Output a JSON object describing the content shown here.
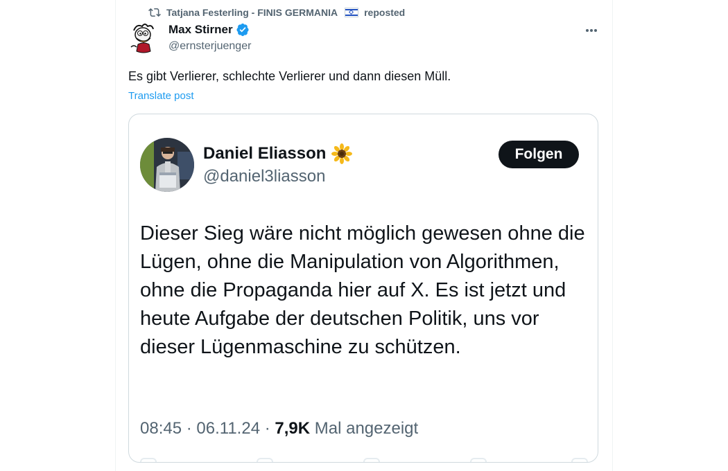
{
  "repost": {
    "reposter": "Tatjana Festerling - FINIS GERMANIA",
    "suffix": "reposted",
    "icon": "repost-icon",
    "flag": "israel-flag-emoji"
  },
  "post": {
    "author_name": "Max Stirner",
    "author_handle": "@ernsterjuenger",
    "verified_icon": "verified-badge-icon",
    "avatar": "duck-avatar",
    "text": "Es gibt Verlierer, schlechte Verlierer und dann diesen Müll.",
    "translate_label": "Translate post",
    "more_icon": "more-icon"
  },
  "embed": {
    "name": "Daniel Eliasson",
    "name_emoji": "sunflower-emoji",
    "handle": "@daniel3liasson",
    "follow_label": "Folgen",
    "text": "Dieser Sieg wäre nicht möglich gewesen ohne die Lügen, ohne die Manipulation von Algorithmen, ohne die Propaganda hier auf X. Es ist jetzt und heute Aufgabe der deutschen Politik, uns vor dieser Lügenmaschine zu schützen.",
    "time": "08:45",
    "date": "06.11.24",
    "views": "7,9K",
    "views_label": "Mal angezeigt",
    "separator": "·"
  },
  "colors": {
    "accent": "#1d9bf0",
    "text": "#0f1419",
    "muted": "#536471",
    "border": "#cfd9de",
    "follow_bg": "#0f1419"
  }
}
